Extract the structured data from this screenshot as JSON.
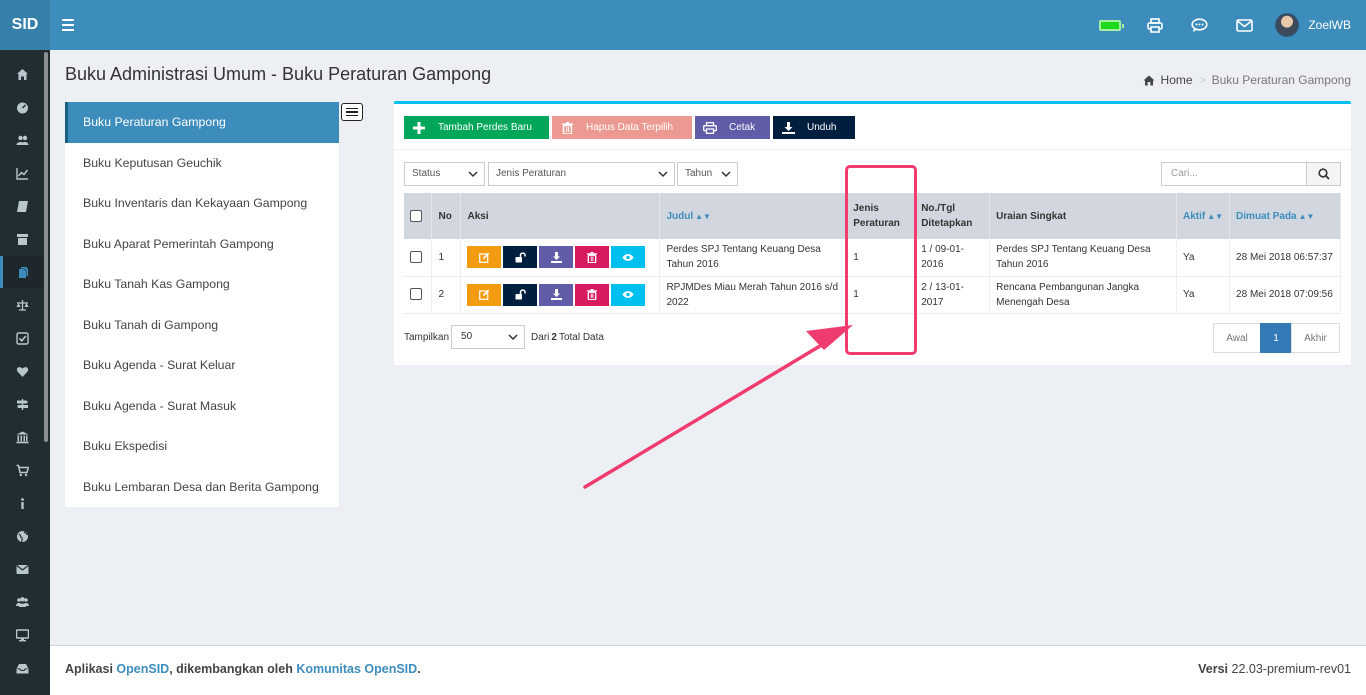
{
  "header": {
    "logo": "SID",
    "username": "ZoelWB",
    "icons": [
      "battery-icon",
      "print-icon",
      "chat-icon",
      "mail-icon"
    ]
  },
  "sidebar": {
    "icons": [
      "home-icon",
      "dashboard-icon",
      "users-icon",
      "chart-icon",
      "book-icon",
      "archive-icon",
      "files-icon",
      "scale-icon",
      "check-icon",
      "heart-icon",
      "signpost-icon",
      "bank-icon",
      "cart-icon",
      "info-icon",
      "globe-icon",
      "envelope-icon",
      "group-icon",
      "desktop-icon",
      "inbox-icon"
    ],
    "active_index": 6
  },
  "page": {
    "title": "Buku Administrasi Umum - Buku Peraturan Gampong",
    "breadcrumb": {
      "home": "Home",
      "current": "Buku Peraturan Gampong"
    }
  },
  "subnav": {
    "items": [
      "Buku Peraturan Gampong",
      "Buku Keputusan Geuchik",
      "Buku Inventaris dan Kekayaan Gampong",
      "Buku Aparat Pemerintah Gampong",
      "Buku Tanah Kas Gampong",
      "Buku Tanah di Gampong",
      "Buku Agenda - Surat Keluar",
      "Buku Agenda - Surat Masuk",
      "Buku Ekspedisi",
      "Buku Lembaran Desa dan Berita Gampong"
    ],
    "active_index": 0
  },
  "toolbar": {
    "add": "Tambah Perdes Baru",
    "delete": "Hapus Data Terpilih",
    "print": "Cetak",
    "download": "Unduh",
    "colors": {
      "add": "#00a65a",
      "delete": "#ec9a91",
      "print": "#605ca8",
      "download": "#001f3f"
    }
  },
  "filters": {
    "status": "Status",
    "jenis": "Jenis Peraturan",
    "tahun": "Tahun",
    "search_placeholder": "Cari..."
  },
  "table": {
    "headers": {
      "no": "No",
      "aksi": "Aksi",
      "judul": "Judul",
      "jenis_1": "Jenis",
      "jenis_2": "Peraturan",
      "notgl_1": "No./Tgl",
      "notgl_2": "Ditetapkan",
      "uraian": "Uraian Singkat",
      "aktif": "Aktif",
      "dimuat": "Dimuat Pada"
    },
    "rows": [
      {
        "no": "1",
        "judul_1": "Perdes SPJ Tentang Keuang Desa",
        "judul_2": "Tahun 2016",
        "jenis": "1",
        "notgl_1": "1 / 09-01-",
        "notgl_2": "2016",
        "uraian_1": "Perdes SPJ Tentang Keuang Desa",
        "uraian_2": "Tahun 2016",
        "aktif": "Ya",
        "dimuat": "28 Mei 2018 06:57:37"
      },
      {
        "no": "2",
        "judul_1": "RPJMDes Miau Merah Tahun 2016 s/d",
        "judul_2": "2022",
        "jenis": "1",
        "notgl_1": "2 / 13-01-",
        "notgl_2": "2017",
        "uraian_1": "Rencana Pembangunan Jangka",
        "uraian_2": "Menengah Desa",
        "aktif": "Ya",
        "dimuat": "28 Mei 2018 07:09:56"
      }
    ],
    "action_colors": [
      "#f39c12",
      "#001f3f",
      "#605ca8",
      "#d81b60",
      "#00c0ef"
    ]
  },
  "pagination": {
    "show_label": "Tampilkan",
    "per_page": "50",
    "from_label": "Dari",
    "total": "2",
    "total_label": "Total Data",
    "first": "Awal",
    "current": "1",
    "last": "Akhir"
  },
  "footer": {
    "prefix": "Aplikasi",
    "app": "OpenSID",
    "middle": ", dikembangkan oleh",
    "community": "Komunitas OpenSID",
    "suffix": ".",
    "version_label": "Versi",
    "version": "22.03-premium-rev01"
  },
  "annotation_color": "#f03b6e"
}
